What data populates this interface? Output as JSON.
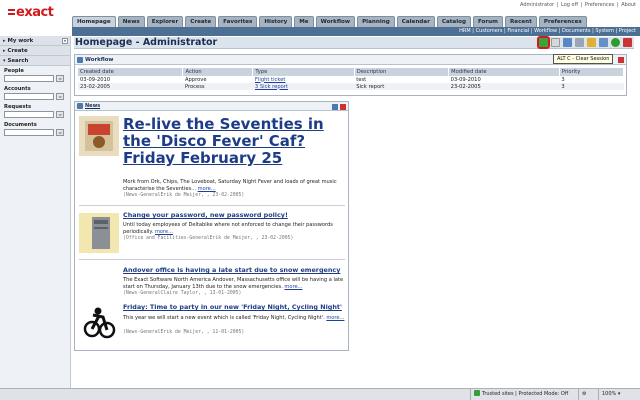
{
  "header": {
    "logo_text": "exact",
    "top_links": [
      "Administrator",
      "Log off",
      "Preferences",
      "About"
    ],
    "tabs": [
      "Homepage",
      "News",
      "Explorer",
      "Create",
      "Favorites",
      "History",
      "Me",
      "Workflow",
      "Planning",
      "Calendar",
      "Catalog",
      "Forum",
      "Recent",
      "Preferences"
    ],
    "active_tab": "Homepage"
  },
  "subbar": {
    "links": [
      "HRM",
      "Customers",
      "Financial",
      "Workflow",
      "Documents",
      "System",
      "Project"
    ]
  },
  "sidebar": {
    "sections": [
      "My work",
      "Create",
      "Search"
    ],
    "fields": [
      {
        "label": "People"
      },
      {
        "label": "Accounts"
      },
      {
        "label": "Requests"
      },
      {
        "label": "Documents"
      }
    ]
  },
  "main": {
    "title": "Homepage - Administrator",
    "tooltip": "ALT C - Clear Session"
  },
  "workflow": {
    "title": "Workflow",
    "columns": [
      "Created date",
      "Action",
      "Type",
      "Description",
      "Modified date",
      "Priority"
    ],
    "rows": [
      {
        "created": "03-09-2010",
        "action": "Approve",
        "type": "Flight ticket",
        "description": "test",
        "modified": "03-09-2010",
        "priority": "3"
      },
      {
        "created": "23-02-2005",
        "action": "Process",
        "type": "3 Sick report",
        "description": "Sick report",
        "modified": "23-02-2005",
        "priority": "3"
      }
    ]
  },
  "news": {
    "title": "News",
    "items": [
      {
        "headline": "Re-live the Seventies in the 'Disco Fever' Caf? Friday February 25",
        "body": "Mork from Ork, Chips, The Loveboat, Saturday Night Fever and loads of great music characterise the Seventies...",
        "more": "more...",
        "meta": "(News-GeneralErik de Meijer, , 23-02-2005)"
      },
      {
        "headline": "Change your password, new password policy!",
        "body": "Until today employees of Deltabike where not enforced to change their passwords periodically.",
        "more": "more...",
        "meta": "(Office and Facilities-GeneralErik de Meijer, , 23-02-2005)"
      },
      {
        "headline": "Andover office is having a late start due to snow emergency",
        "body": "The Exact Software North America Andover, Massachusetts office will be having a late start on Thursday, January 13th due to the snow emergencies.",
        "more": "more...",
        "meta": "(News-GeneralClaire Taylor, , 13-01-2005)"
      },
      {
        "headline": "Friday: Time to party in our new 'Friday Night, Cycling Night'",
        "body": "This year we will start a new event which is called 'Friday Night, Cycling Night'.",
        "more": "more...",
        "meta": "(News-GeneralErik de Meijer, , 11-01-2005)"
      }
    ]
  },
  "statusbar": {
    "zone": "Trusted sites | Protected Mode: Off",
    "zoom": "100%"
  },
  "colors": {
    "brand": "#d21a1a",
    "nav_blue": "#4d6f94",
    "link": "#1d3c85"
  }
}
